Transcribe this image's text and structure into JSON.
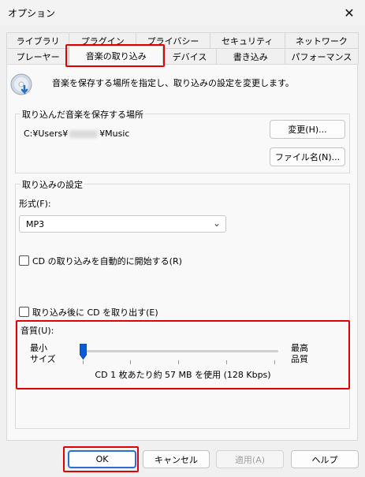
{
  "window": {
    "title": "オプション"
  },
  "tabs": {
    "row1": [
      "ライブラリ",
      "プラグイン",
      "プライバシー",
      "セキュリティ",
      "ネットワーク"
    ],
    "row2": [
      "プレーヤー",
      "音楽の取り込み",
      "デバイス",
      "書き込み",
      "パフォーマンス"
    ],
    "active": "音楽の取り込み"
  },
  "intro": {
    "text": "音楽を保存する場所を指定し、取り込みの設定を変更します。"
  },
  "save_location": {
    "group_label": "取り込んだ音楽を保存する場所",
    "path_prefix": "C:¥Users¥",
    "path_suffix": "¥Music",
    "change_button": "変更(H)...",
    "filename_button": "ファイル名(N)..."
  },
  "rip_settings": {
    "group_label": "取り込みの設定",
    "format_label": "形式(F):",
    "format_value": "MP3",
    "auto_rip_label": "CD の取り込みを自動的に開始する(R)",
    "auto_rip_checked": false,
    "eject_label": "取り込み後に CD を取り出す(E)",
    "eject_checked": false,
    "quality": {
      "label": "音質(U):",
      "min_label_line1": "最小",
      "min_label_line2": "サイズ",
      "max_label_line1": "最高",
      "max_label_line2": "品質",
      "level": 0,
      "info": "CD 1 枚あたり約 57 MB を使用 (128 Kbps)"
    }
  },
  "footer": {
    "ok": "OK",
    "cancel": "キャンセル",
    "apply": "適用(A)",
    "help": "ヘルプ"
  },
  "colors": {
    "highlight": "#e00000",
    "accent": "#0a5bd3"
  }
}
